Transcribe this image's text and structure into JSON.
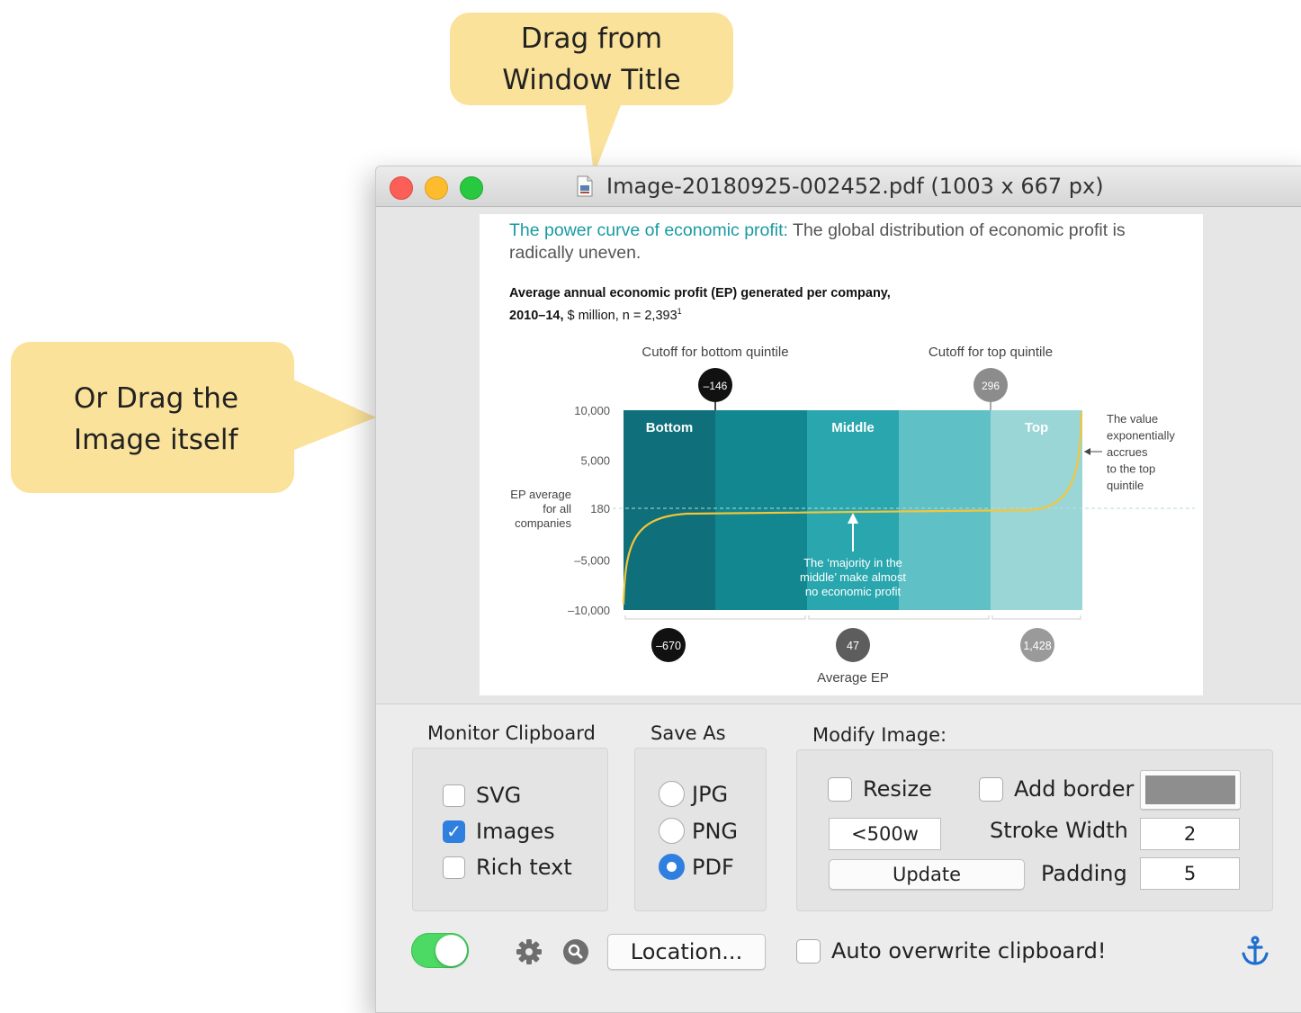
{
  "callouts": {
    "top": [
      "Drag from",
      "Window Title"
    ],
    "left": [
      "Or Drag the",
      "Image itself"
    ]
  },
  "window": {
    "title": "Image-20180925-002452.pdf (1003 x 667 px)"
  },
  "image": {
    "title_lead": "The power curve of economic profit:",
    "title_rest": " The global distribution of economic profit is radically uneven.",
    "subtitle_bold_1": "Average annual economic profit (EP) generated per company,",
    "subtitle_bold_2": "2010–14,",
    "subtitle_rest": " $ million, n = 2,393",
    "subtitle_sup": "1"
  },
  "chart_data": {
    "type": "area",
    "y_ticks": [
      "10,000",
      "5,000",
      "180",
      "–5,000",
      "–10,000"
    ],
    "ylim": [
      -10000,
      10000
    ],
    "bands": [
      "Bottom",
      "",
      "Middle",
      "",
      "Top"
    ],
    "band_colors": [
      "#0f6f7a",
      "#128790",
      "#2aa7ae",
      "#5fc0c5",
      "#9bd6d7"
    ],
    "curve_color": "#f2c63a",
    "reference_line": {
      "value": 180,
      "label": [
        "EP average",
        "for all",
        "companies"
      ]
    },
    "cutoffs": [
      {
        "label": "Cutoff for bottom quintile",
        "value": "–146"
      },
      {
        "label": "Cutoff for top quintile",
        "value": "296"
      }
    ],
    "averages": {
      "label": "Average EP",
      "values": [
        "–670",
        "47",
        "1,428"
      ]
    },
    "annotation_middle": [
      "The ‘majority in the",
      "middle’ make almost",
      "no economic profit"
    ],
    "annotation_top": [
      "The value",
      "exponentially",
      "accrues",
      "to the top",
      "quintile"
    ]
  },
  "controls": {
    "monitor": {
      "label": "Monitor Clipboard",
      "items": [
        {
          "label": "SVG",
          "checked": false
        },
        {
          "label": "Images",
          "checked": true
        },
        {
          "label": "Rich text",
          "checked": false
        }
      ]
    },
    "save_as": {
      "label": "Save As",
      "options": [
        {
          "label": "JPG",
          "selected": false
        },
        {
          "label": "PNG",
          "selected": false
        },
        {
          "label": "PDF",
          "selected": true
        }
      ]
    },
    "modify": {
      "label": "Modify Image:",
      "resize_label": "Resize",
      "resize_value": "<500w",
      "update_label": "Update",
      "add_border_label": "Add border",
      "border_color": "#8e8e8e",
      "stroke_width_label": "Stroke Width",
      "stroke_width_value": "2",
      "padding_label": "Padding",
      "padding_value": "5"
    },
    "bottom": {
      "location_label": "Location...",
      "auto_overwrite_label": "Auto overwrite clipboard!",
      "toggle_on": true
    }
  },
  "colors": {
    "accent": "#2f7fe0",
    "toggle": "#4cd964",
    "callout": "#fbe29a",
    "anchor": "#1f6fd1"
  }
}
